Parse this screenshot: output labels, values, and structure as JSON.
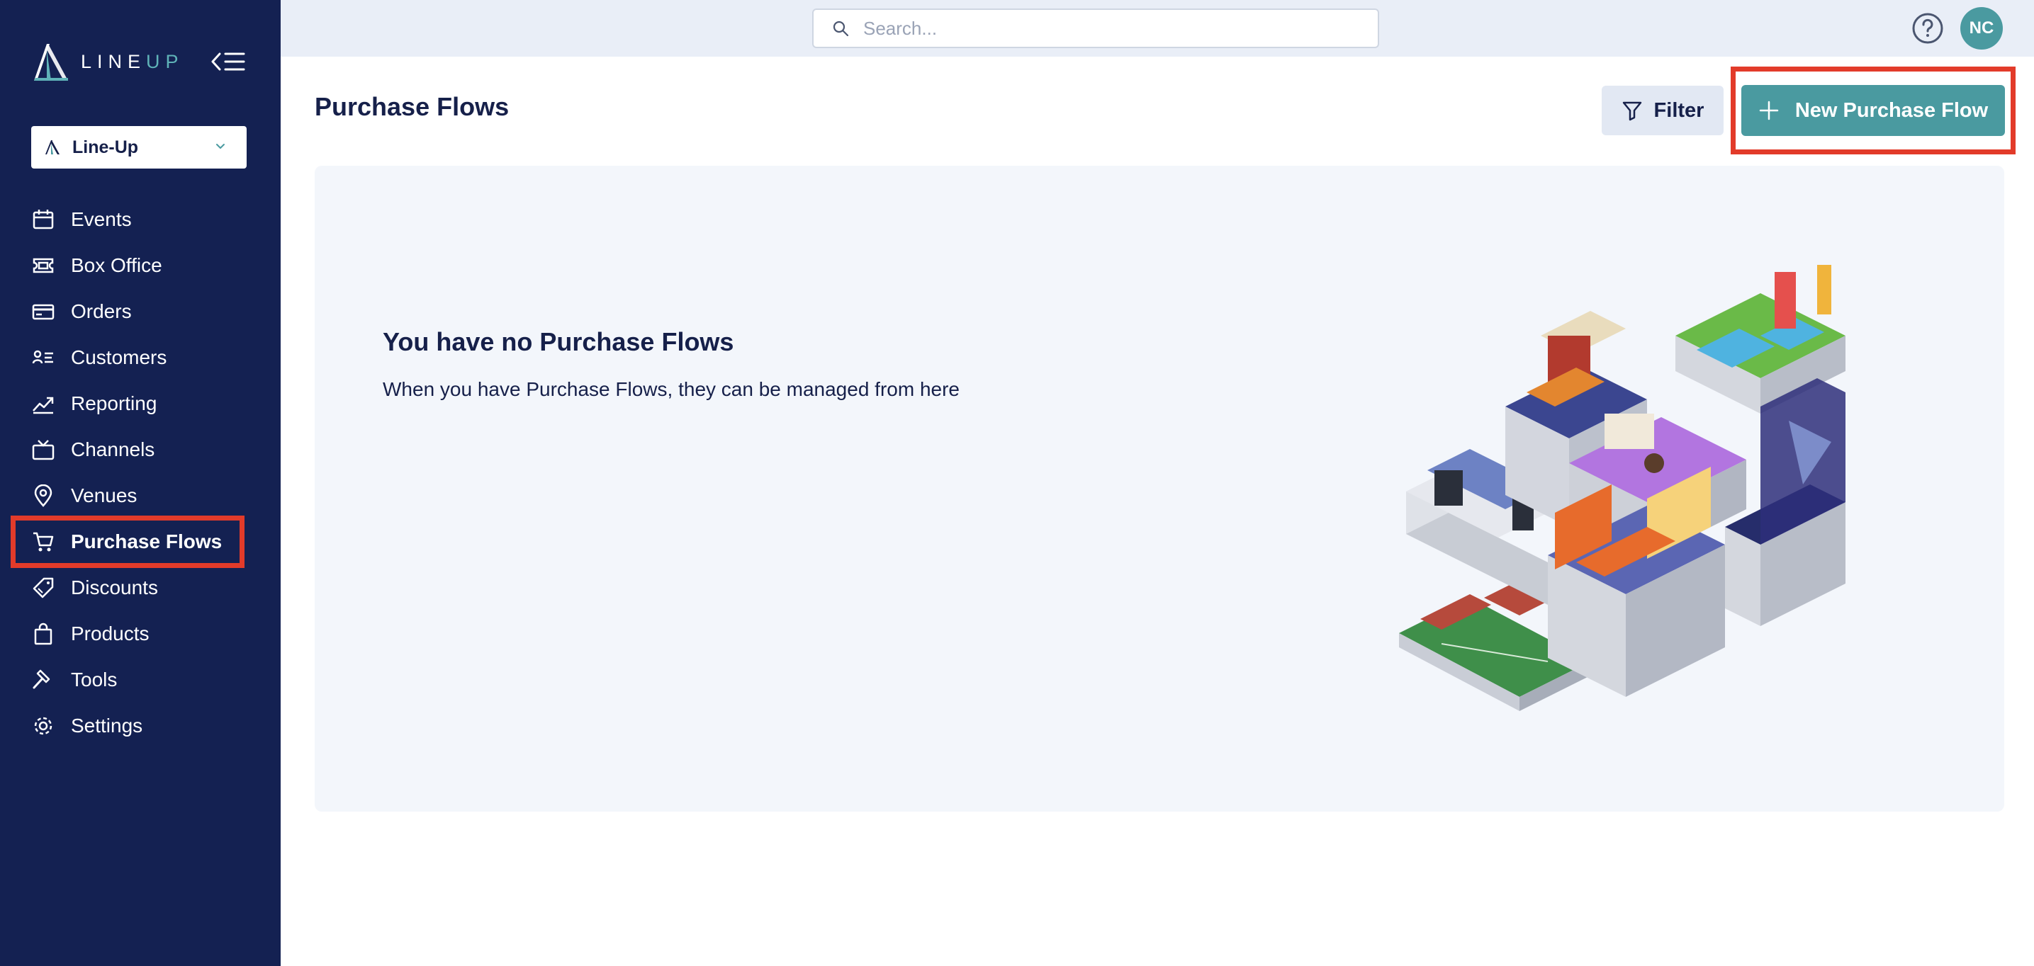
{
  "app": {
    "logo_line": "LINE",
    "logo_up": "UP"
  },
  "org_select": {
    "value": "Line-Up"
  },
  "sidebar": {
    "items": [
      {
        "label": "Events",
        "icon": "calendar-icon"
      },
      {
        "label": "Box Office",
        "icon": "ticket-icon"
      },
      {
        "label": "Orders",
        "icon": "credit-card-icon"
      },
      {
        "label": "Customers",
        "icon": "customer-list-icon"
      },
      {
        "label": "Reporting",
        "icon": "trend-chart-icon"
      },
      {
        "label": "Channels",
        "icon": "tv-icon"
      },
      {
        "label": "Venues",
        "icon": "map-pin-icon"
      },
      {
        "label": "Purchase Flows",
        "icon": "cart-icon",
        "active": true
      },
      {
        "label": "Discounts",
        "icon": "tag-icon"
      },
      {
        "label": "Products",
        "icon": "shopping-bag-icon"
      },
      {
        "label": "Tools",
        "icon": "hammer-icon"
      },
      {
        "label": "Settings",
        "icon": "gear-icon"
      }
    ]
  },
  "topbar": {
    "search_placeholder": "Search...",
    "avatar_initials": "NC"
  },
  "main": {
    "title": "Purchase Flows",
    "filter_label": "Filter",
    "new_button_label": "New Purchase Flow",
    "empty_title": "You have no Purchase Flows",
    "empty_description": "When you have Purchase Flows, they can be managed from here"
  },
  "colors": {
    "sidebar_bg": "#142152",
    "accent": "#4a9aa0",
    "highlight": "#e23b2a",
    "topbar_bg": "#e9eef7"
  }
}
